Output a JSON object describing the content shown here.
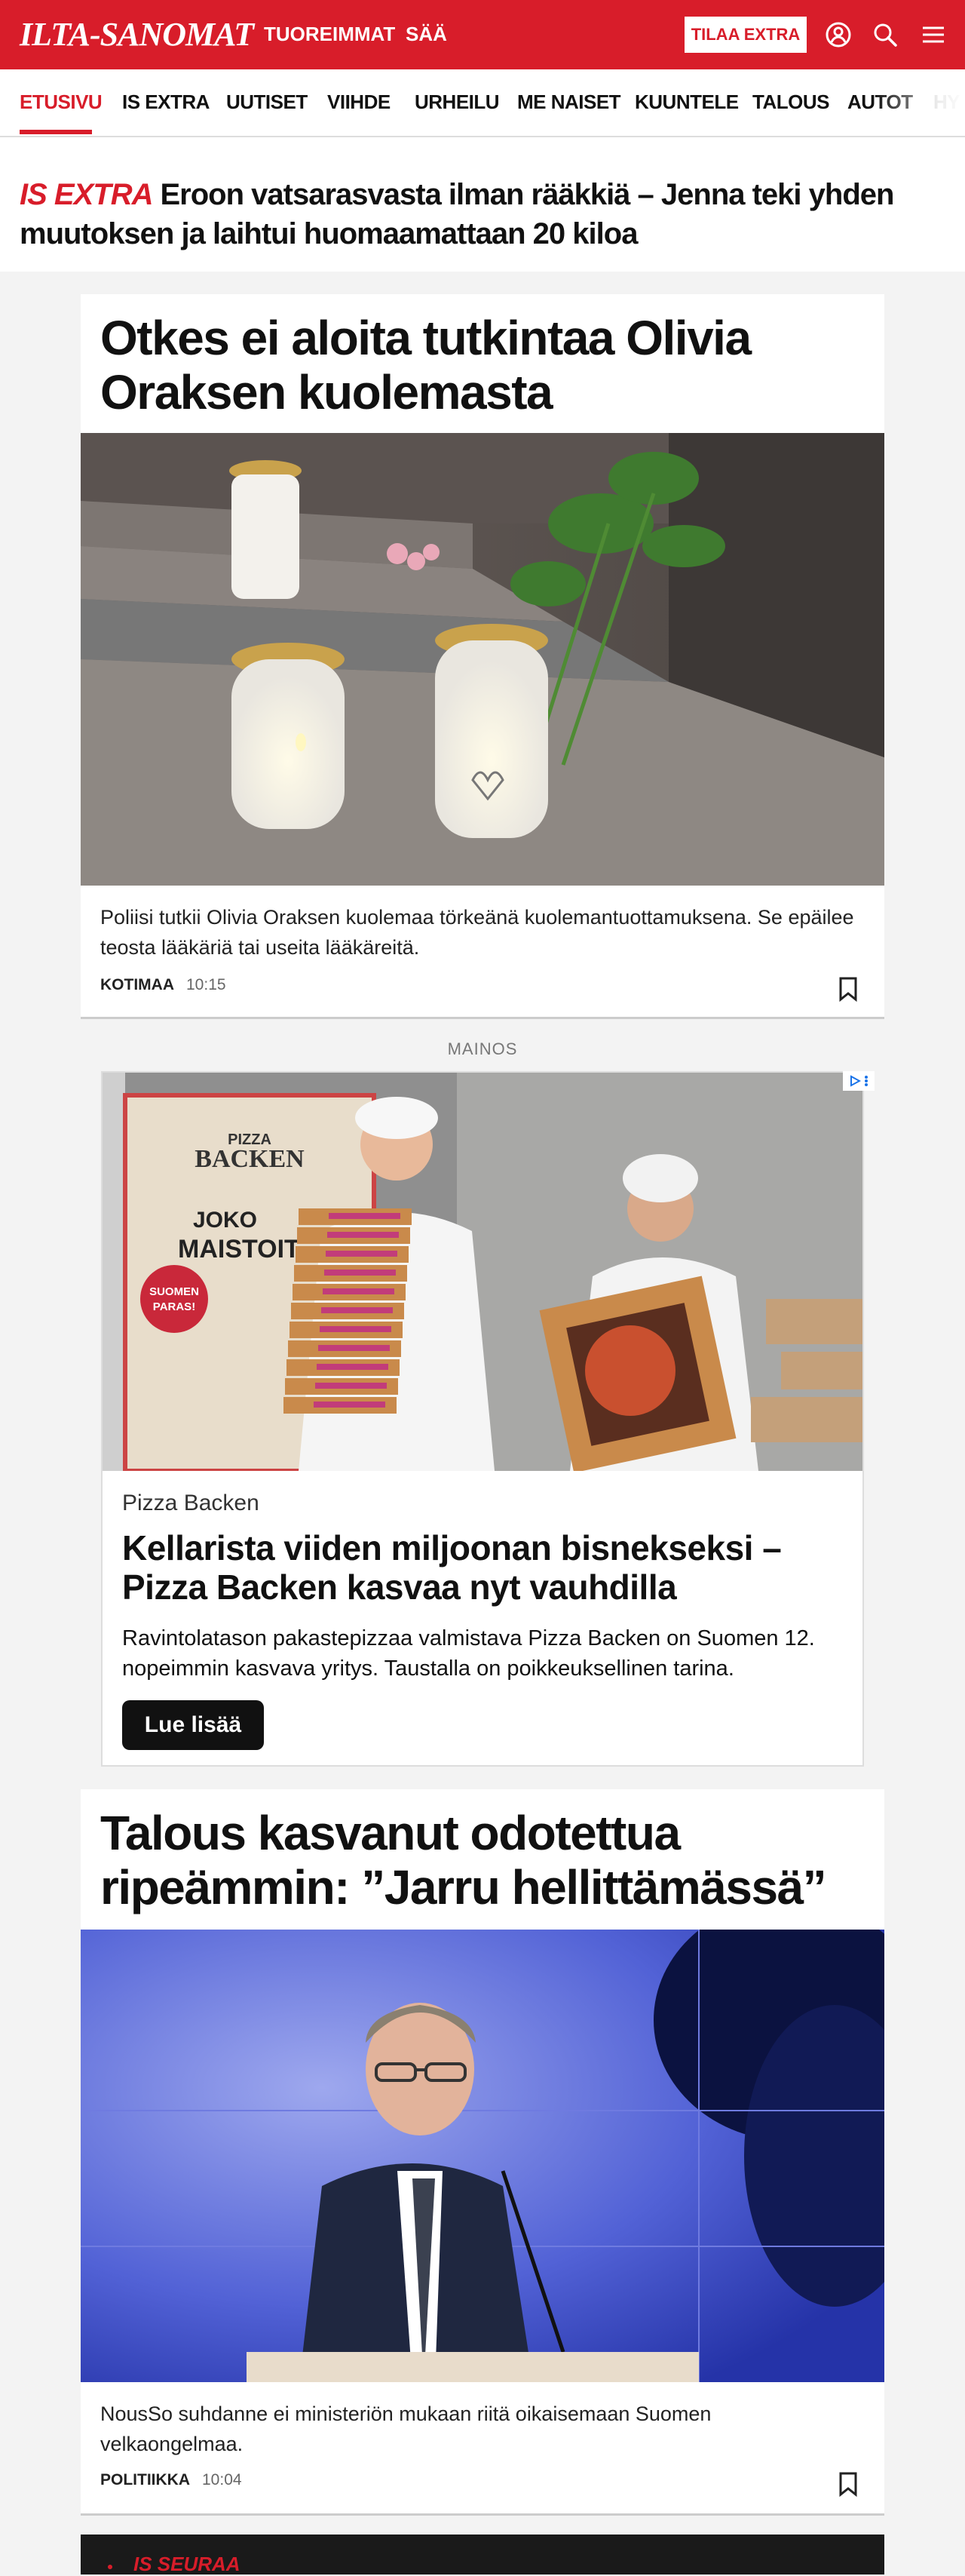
{
  "topbar": {
    "logo": "ILTA-SANOMAT",
    "nav": [
      "TUOREIMMAT",
      "SÄÄ"
    ],
    "subscribe_label": "TILAA EXTRA",
    "icons": [
      "user-icon",
      "search-icon",
      "menu-icon"
    ],
    "brand_color": "#d81d2a"
  },
  "sections": {
    "items": [
      "ETUSIVU",
      "IS EXTRA",
      "UUTISET",
      "VIIHDE",
      "URHEILU",
      "ME NAISET",
      "KUUNTELE",
      "TALOUS",
      "AUTOT",
      "HY"
    ],
    "active": "ETUSIVU"
  },
  "extra_banner": {
    "tag": "IS EXTRA",
    "title": "Eroon vatsarasvasta ilman rääkkiä – Jenna teki yhden muutoksen ja laihtui huomaamattaan 20 kiloa"
  },
  "articles": [
    {
      "headline": "Otkes ei aloita tutkintaa Olivia Oraksen kuolemasta",
      "image": "candles-on-stairs-photo",
      "lead": "Poliisi tutkii Olivia Oraksen kuolemaa törkeänä kuolemantuottamuksena. Se epäilee teosta lääkäriä tai useita lääkäreitä.",
      "category": "KOTIMAA",
      "time": "10:15"
    },
    {
      "headline": "Talous kasvanut odotettua ripeämmin: ”Jarru hellittämässä”",
      "image": "speaker-at-podium-photo",
      "lead": "NousSo suhdanne ei ministeriön mukaan riitä oikaisemaan Suomen velkaongelmaa.",
      "category": "POLITIIKKA",
      "time": "10:04"
    }
  ],
  "ad": {
    "label": "MAINOS",
    "brand": "Pizza Backen",
    "title": "Kellarista viiden miljoonan bisnekseksi – Pizza Backen kasvaa nyt vauhdilla",
    "description": "Ravintolatason pakastepizzaa valmistava Pizza Backen on Suomen 12. nopeimmin kasvava yritys. Taustalla on poikkeuksellinen tarina.",
    "button_label": "Lue lisää",
    "image_text": {
      "box_brand_line1": "PIZZA",
      "box_brand_line2": "BACKEN",
      "poster_line1": "JOKO",
      "poster_line2": "MAISTOIT",
      "badge_line1": "SUOMEN",
      "badge_line2": "PARAS!"
    }
  },
  "follow_section": {
    "title": "IS SEURAA"
  }
}
